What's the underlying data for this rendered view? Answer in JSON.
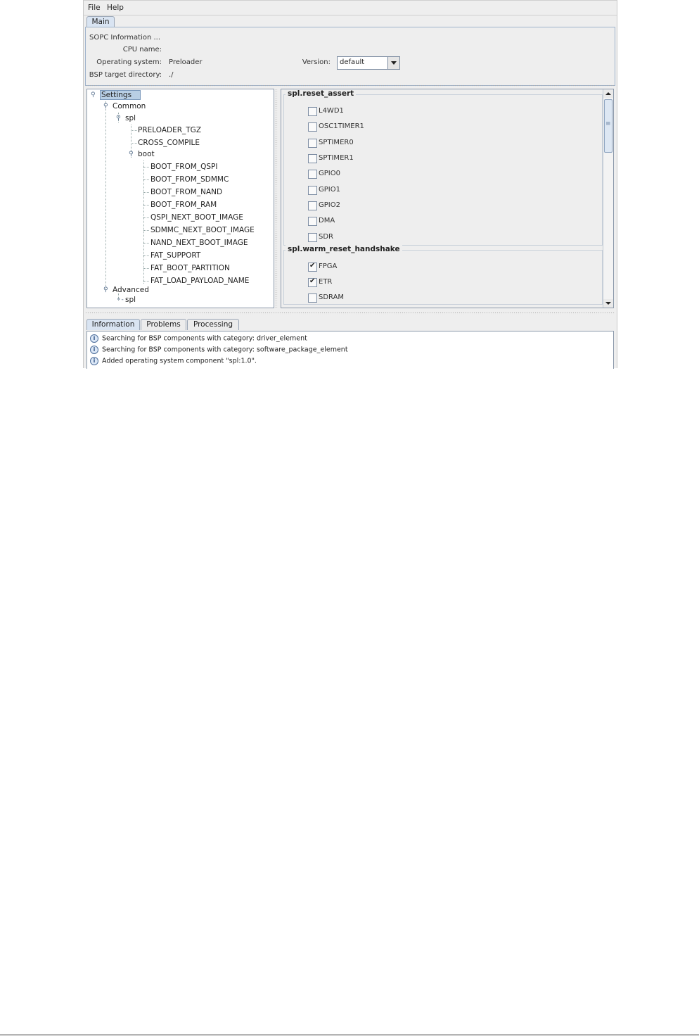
{
  "menubar": {
    "file": "File",
    "help": "Help"
  },
  "top_tabs": [
    {
      "label": "Main"
    }
  ],
  "sopc": {
    "header": "SOPC Information ...",
    "cpu_label": "CPU name:",
    "cpu_value": "",
    "os_label": "Operating system:",
    "os_value": "Preloader",
    "version_label": "Version:",
    "version_value": "default",
    "bsp_label": "BSP target directory:",
    "bsp_value": "./"
  },
  "tree": {
    "settings": "Settings",
    "common": "Common",
    "spl": "spl",
    "preloader_tgz": "PRELOADER_TGZ",
    "cross_compile": "CROSS_COMPILE",
    "boot": "boot",
    "boot_items": [
      "BOOT_FROM_QSPI",
      "BOOT_FROM_SDMMC",
      "BOOT_FROM_NAND",
      "BOOT_FROM_RAM",
      "QSPI_NEXT_BOOT_IMAGE",
      "SDMMC_NEXT_BOOT_IMAGE",
      "NAND_NEXT_BOOT_IMAGE",
      "FAT_SUPPORT",
      "FAT_BOOT_PARTITION",
      "FAT_LOAD_PAYLOAD_NAME"
    ],
    "advanced": "Advanced",
    "advanced_spl": "spl"
  },
  "reset_assert": {
    "title": "spl.reset_assert",
    "items": [
      {
        "label": "L4WD1",
        "checked": false
      },
      {
        "label": "OSC1TIMER1",
        "checked": false
      },
      {
        "label": "SPTIMER0",
        "checked": false
      },
      {
        "label": "SPTIMER1",
        "checked": false
      },
      {
        "label": "GPIO0",
        "checked": false
      },
      {
        "label": "GPIO1",
        "checked": false
      },
      {
        "label": "GPIO2",
        "checked": false
      },
      {
        "label": "DMA",
        "checked": false
      },
      {
        "label": "SDR",
        "checked": false
      }
    ]
  },
  "warm_reset": {
    "title": "spl.warm_reset_handshake",
    "items": [
      {
        "label": "FPGA",
        "checked": true
      },
      {
        "label": "ETR",
        "checked": true
      },
      {
        "label": "SDRAM",
        "checked": false
      }
    ]
  },
  "bottom_tabs": [
    {
      "label": "Information"
    },
    {
      "label": "Problems"
    },
    {
      "label": "Processing"
    }
  ],
  "log": [
    "Searching for BSP components with category: driver_element",
    "Searching for BSP components with category: software_package_element",
    "Added operating system component \"spl:1.0\"."
  ]
}
